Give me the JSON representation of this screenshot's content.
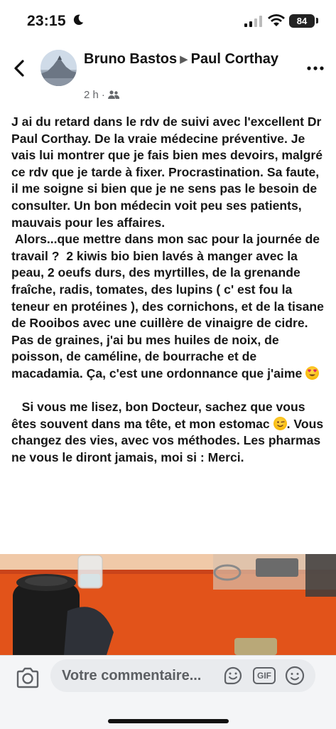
{
  "status_bar": {
    "time": "23:15",
    "battery": "84",
    "icons": [
      "moon-icon",
      "signal-icon",
      "wifi-icon",
      "battery-icon"
    ]
  },
  "header": {
    "author": "Bruno Bastos",
    "separator": "▶",
    "recipient": "Paul Corthay",
    "time_ago": "2 h",
    "dot": "·",
    "audience_icon": "friends-icon",
    "back_icon": "chevron-left-icon",
    "more_icon": "more-horizontal-icon"
  },
  "post": {
    "paragraph1": "J ai du retard dans le rdv de suivi avec l'excellent Dr Paul Corthay. De la vraie médecine préventive. Je vais lui montrer que je fais bien mes devoirs, malgré ce rdv que je tarde à fixer. Procrastination. Sa faute, il me soigne si bien que je ne sens pas le besoin de consulter. Un bon médecin voit peu ses patients, mauvais pour les affaires.",
    "paragraph2": " Alors...que mettre dans mon sac pour la journée de travail ?  2 kiwis bio bien lavés à manger avec la peau, 2 oeufs durs, des myrtilles, de la grenande fraîche, radis, tomates, des lupins ( c' est fou la teneur en protéines ), des cornichons, et de la tisane de Rooibos avec une cuillère de vinaigre de cidre. Pas de graines, j'ai bu mes huiles de noix, de poisson, de caméline, de bourrache et de macadamia. Ça, c'est une ordonnance que j'aime",
    "paragraph3_a": "   Si vous me lisez, bon Docteur, sachez que vous êtes souvent dans ma tête, et mon estomac",
    "paragraph3_b": ". Vous changez des vies, avec vos méthodes. Les pharmas ne vous le diront jamais, moi si : Merci.",
    "emoji1": "heart-eyes-emoji",
    "emoji2": "wink-emoji"
  },
  "comment_bar": {
    "placeholder": "Votre commentaire...",
    "gif_label": "GIF",
    "icons": [
      "camera-icon",
      "sticker-icon",
      "gif-icon",
      "smiley-icon"
    ]
  },
  "colors": {
    "photo_orange": "#e2531a",
    "text": "#171717",
    "meta": "#65676b",
    "bar_bg": "#f4f5f7"
  }
}
